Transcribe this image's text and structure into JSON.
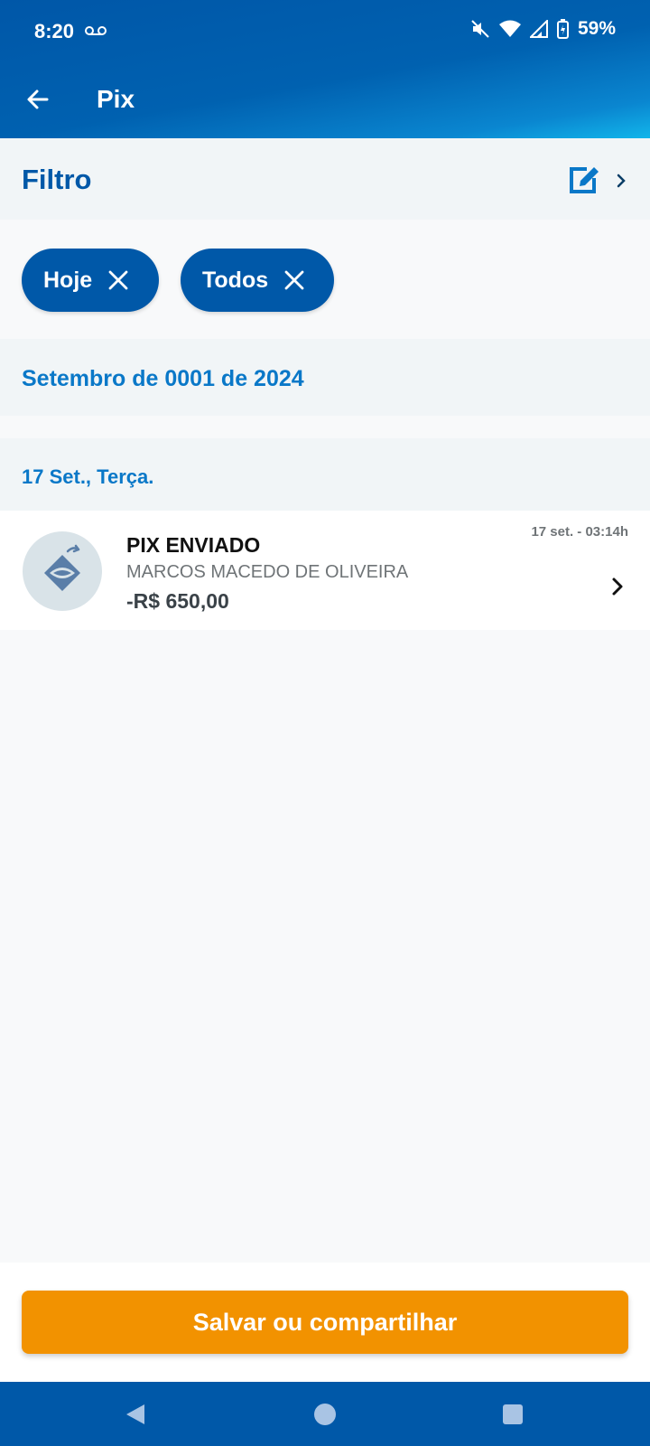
{
  "status_bar": {
    "time": "8:20",
    "battery": "59%",
    "icons": [
      "voicemail-icon",
      "mute-icon",
      "wifi-icon",
      "signal-icon",
      "battery-charging-icon"
    ]
  },
  "header": {
    "title": "Pix",
    "back_icon": "arrow-left-icon"
  },
  "filter": {
    "title": "Filtro",
    "edit_icon": "edit-icon",
    "chips": [
      {
        "label": "Hoje"
      },
      {
        "label": "Todos"
      }
    ]
  },
  "month_label": "Setembro de 0001 de 2024",
  "day_label": "17 Set., Terça.",
  "transaction": {
    "type": "PIX ENVIADO",
    "name": "MARCOS MACEDO DE OLIVEIRA",
    "amount": "-R$ 650,00",
    "time": "17 set. - 03:14h"
  },
  "footer": {
    "button_label": "Salvar ou compartilhar"
  },
  "colors": {
    "primary": "#0058a8",
    "accent": "#f29200",
    "link_blue": "#0a78c8"
  }
}
